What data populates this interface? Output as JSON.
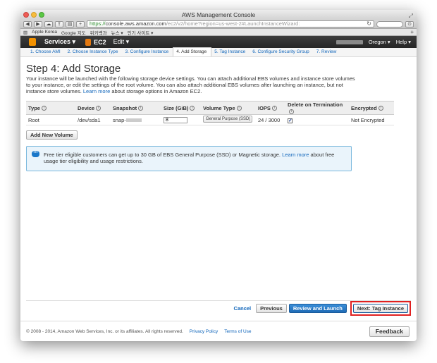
{
  "window": {
    "title": "AWS Management Console"
  },
  "browser": {
    "address_host": "https://",
    "address_domain": "console.aws.amazon.com",
    "address_path": "/ec2/v2/home?region=us-west-2#LaunchInstanceWizard:",
    "bookmarks": [
      "Apple Korea",
      "Google 지도",
      "위키백과",
      "뉴스 ▾",
      "인기 사이트 ▾"
    ]
  },
  "nav": {
    "services_label": "Services",
    "ec2_label": "EC2",
    "edit_label": "Edit",
    "region_label": "Oregon",
    "help_label": "Help"
  },
  "steps": [
    "1. Choose AMI",
    "2. Choose Instance Type",
    "3. Configure Instance",
    "4. Add Storage",
    "5. Tag Instance",
    "6. Configure Security Group",
    "7. Review"
  ],
  "page": {
    "title": "Step 4: Add Storage",
    "description": "Your instance will be launched with the following storage device settings. You can attach additional EBS volumes and instance store volumes to your instance, or edit the settings of the root volume. You can also attach additional EBS volumes after launching an instance, but not instance store volumes.",
    "learn_more": "Learn more",
    "description_tail": "about storage options in Amazon EC2."
  },
  "table": {
    "headers": [
      "Type",
      "Device",
      "Snapshot",
      "Size (GiB)",
      "Volume Type",
      "IOPS",
      "Delete on Termination",
      "Encrypted"
    ],
    "row": {
      "type": "Root",
      "device": "/dev/sda1",
      "snapshot_prefix": "snap-",
      "size": "8",
      "volume_type": "General Purpose (SSD)",
      "iops": "24 / 3000",
      "delete_on_termination": true,
      "encrypted": "Not Encrypted"
    }
  },
  "add_volume_label": "Add New Volume",
  "free_tier": {
    "text": "Free tier eligible customers can get up to 30 GB of EBS General Purpose (SSD) or Magnetic storage.",
    "learn_more": "Learn more",
    "tail": "about free usage tier eligibility and usage restrictions."
  },
  "actions": {
    "cancel": "Cancel",
    "previous": "Previous",
    "review_launch": "Review and Launch",
    "next": "Next: Tag Instance"
  },
  "footer": {
    "copyright": "© 2008 - 2014, Amazon Web Services, Inc. or its affiliates. All rights reserved.",
    "privacy": "Privacy Policy",
    "terms": "Terms of Use",
    "feedback": "Feedback"
  },
  "colors": {
    "aws_orange": "#f29100",
    "primary_blue": "#1f6bb5",
    "highlight_red": "#e02020"
  }
}
